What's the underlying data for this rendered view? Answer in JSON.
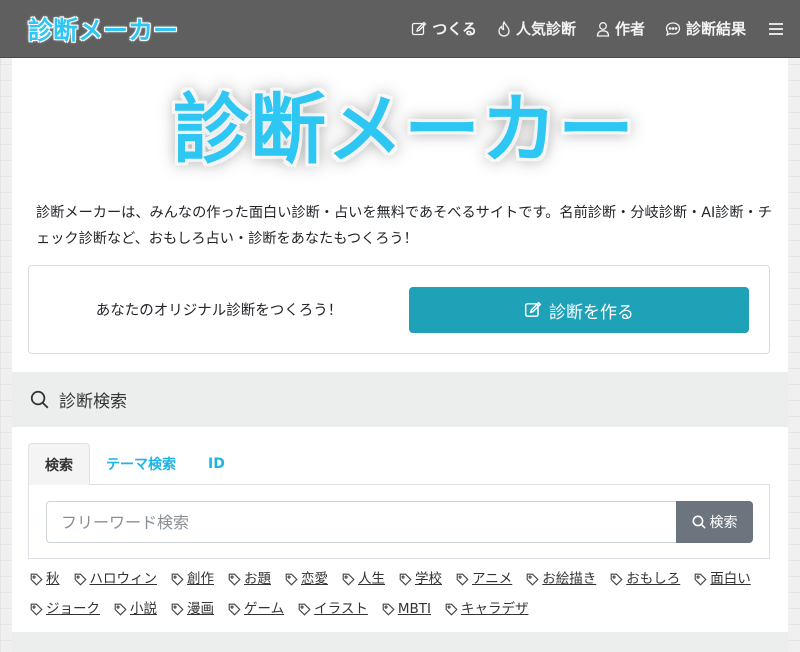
{
  "navbar": {
    "brand": "診断メーカー",
    "links": [
      {
        "label": "つくる",
        "icon": "edit-icon"
      },
      {
        "label": "人気診断",
        "icon": "fire-icon"
      },
      {
        "label": "作者",
        "icon": "person-icon"
      },
      {
        "label": "診断結果",
        "icon": "chat-icon"
      }
    ],
    "menu_icon": "hamburger-icon"
  },
  "hero": {
    "title": "診断メーカー"
  },
  "intro": {
    "text": "診断メーカーは、みんなの作った面白い診断・占いを無料であそべるサイトです。名前診断・分岐診断・AI診断・チェック診断など、おもしろ占い・診断をあなたもつくろう！"
  },
  "create": {
    "prompt": "あなたのオリジナル診断をつくろう！",
    "button_label": "診断を作る",
    "button_color": "#1fa2b8"
  },
  "search": {
    "header": "診断検索",
    "tabs": [
      {
        "label": "検索",
        "active": true
      },
      {
        "label": "テーマ検索",
        "active": false
      },
      {
        "label": "ID",
        "active": false
      }
    ],
    "input_value": "",
    "placeholder": "フリーワード検索",
    "button_label": "検索"
  },
  "tags": {
    "row1": [
      "秋",
      "ハロウィン",
      "創作",
      "お題",
      "恋愛",
      "人生",
      "学校",
      "アニメ",
      "お絵描き",
      "おもしろ",
      "面白い"
    ],
    "row2": [
      "ジョーク",
      "小説",
      "漫画",
      "ゲーム",
      "イラスト",
      "MBTI",
      "キャラデザ"
    ]
  },
  "colors": {
    "brand": "#2ec6f2",
    "navbar_bg": "#5f5f5f",
    "tab_link": "#1fb4e6",
    "search_button": "#6c757d"
  }
}
